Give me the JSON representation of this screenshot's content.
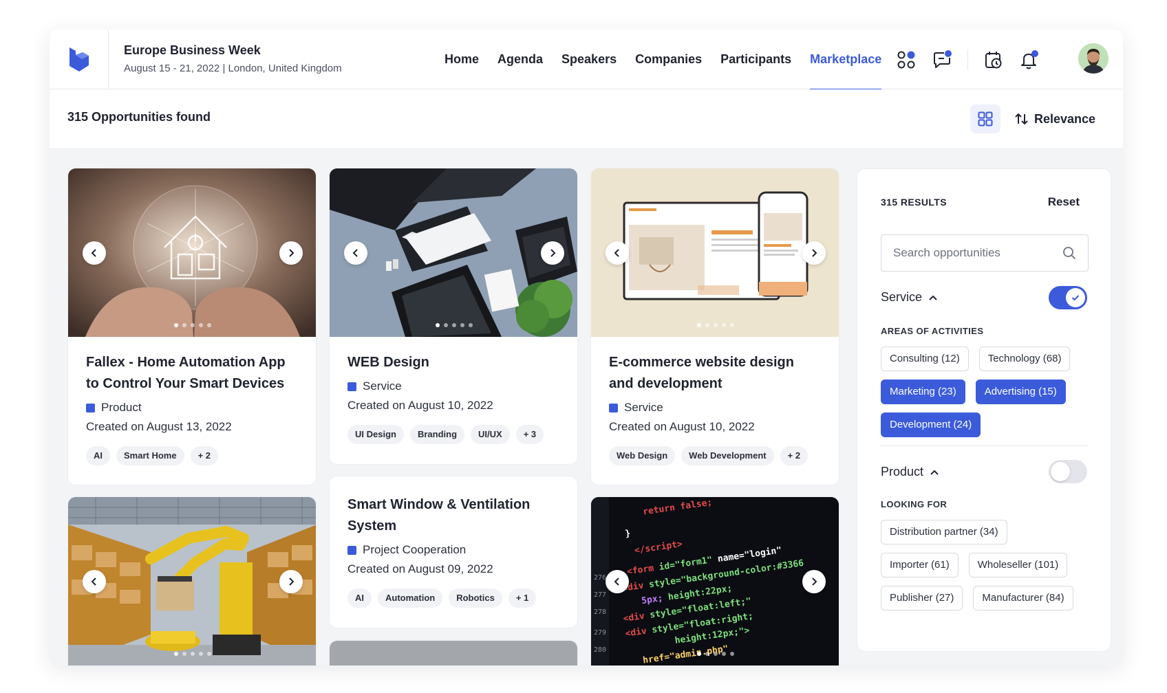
{
  "event": {
    "title": "Europe Business Week",
    "subtitle": "August 15 - 21, 2022 | London, United Kingdom"
  },
  "nav": {
    "items": [
      "Home",
      "Agenda",
      "Speakers",
      "Companies",
      "Participants",
      "Marketplace"
    ],
    "active": "Marketplace"
  },
  "icons": {
    "apps": "apps-icon",
    "chat": "chat-icon",
    "calendar": "calendar-clock-icon",
    "bell": "bell-icon"
  },
  "toolbar": {
    "found": "315 Opportunities found",
    "sort_label": "Relevance"
  },
  "cards": [
    {
      "title": "Fallex - Home Automation App to Control Your Smart Devices",
      "type": "Product",
      "date": "Created on August 13, 2022",
      "tags": [
        "AI",
        "Smart Home",
        "+ 2"
      ]
    },
    {
      "title": "WEB Design",
      "type": "Service",
      "date": "Created on August 10, 2022",
      "tags": [
        "UI Design",
        "Branding",
        "UI/UX",
        "+ 3"
      ]
    },
    {
      "title": "E-commerce website design and development",
      "type": "Service",
      "date": "Created on August 10, 2022",
      "tags": [
        "Web Design",
        "Web Development",
        "+ 2"
      ]
    },
    {
      "title": "Smart Window & Ventilation System",
      "type": "Project Cooperation",
      "date": "Created on August 09, 2022",
      "tags": [
        "AI",
        "Automation",
        "Robotics",
        "+ 1"
      ]
    }
  ],
  "filters": {
    "results": "315 RESULTS",
    "reset": "Reset",
    "search_placeholder": "Search opportunities",
    "service": {
      "label": "Service",
      "enabled": true,
      "group_label": "AREAS OF ACTIVITIES",
      "chips": [
        {
          "label": "Consulting (12)",
          "selected": false
        },
        {
          "label": "Technology (68)",
          "selected": false
        },
        {
          "label": "Marketing (23)",
          "selected": true
        },
        {
          "label": "Advertising (15)",
          "selected": true
        },
        {
          "label": "Development (24)",
          "selected": true
        }
      ]
    },
    "product": {
      "label": "Product",
      "enabled": false,
      "group_label": "LOOKING FOR",
      "chips": [
        {
          "label": "Distribution partner (34)",
          "selected": false
        },
        {
          "label": "Importer (61)",
          "selected": false
        },
        {
          "label": "Wholeseller (101)",
          "selected": false
        },
        {
          "label": "Publisher (27)",
          "selected": false
        },
        {
          "label": "Manufacturer (84)",
          "selected": false
        }
      ]
    }
  },
  "colors": {
    "accent": "#3b5bdb",
    "text": "#1f2330",
    "background": "#f3f4f6"
  }
}
